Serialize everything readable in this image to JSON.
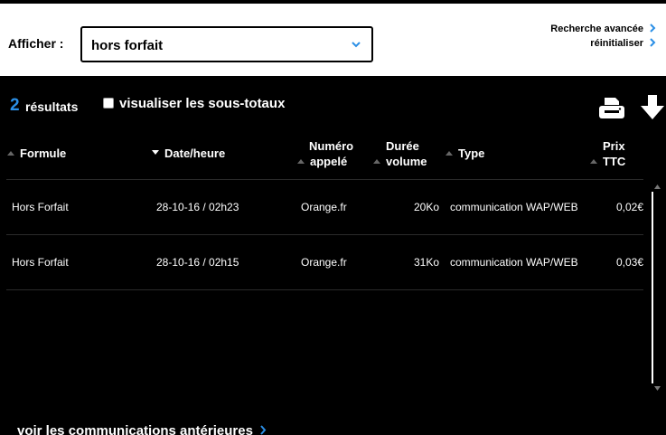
{
  "filter": {
    "label": "Afficher :",
    "selected": "hors forfait"
  },
  "links": {
    "advanced_search": "Recherche avancée",
    "reset": "réinitialiser"
  },
  "results": {
    "count": "2",
    "count_label": "résultats",
    "subtotals_label": "visualiser les sous-totaux",
    "subtotals_checked": false
  },
  "table": {
    "headers": {
      "formule": "Formule",
      "date": "Date/heure",
      "numero_1": "Numéro",
      "numero_2": "appelé",
      "duree_1": "Durée",
      "duree_2": "volume",
      "type": "Type",
      "prix_1": "Prix",
      "prix_2": "TTC"
    },
    "rows": [
      {
        "formule": "Hors Forfait",
        "date": "28-10-16 / 02h23",
        "numero": "Orange.fr",
        "volume": "20Ko",
        "type": "communication WAP/WEB",
        "prix": "0,02€"
      },
      {
        "formule": "Hors Forfait",
        "date": "28-10-16 / 02h15",
        "numero": "Orange.fr",
        "volume": "31Ko",
        "type": "communication WAP/WEB",
        "prix": "0,03€"
      }
    ]
  },
  "footer": {
    "older_link": "voir les communications antérieures"
  },
  "colors": {
    "accent": "#2b8fe6",
    "background": "#000000",
    "filter_bar": "#ffffff"
  },
  "icons": {
    "select": "chevron-down-icon",
    "link": "chevron-right-icon",
    "print": "printer-icon",
    "download": "download-icon",
    "sort": "sort-arrow-icon"
  }
}
